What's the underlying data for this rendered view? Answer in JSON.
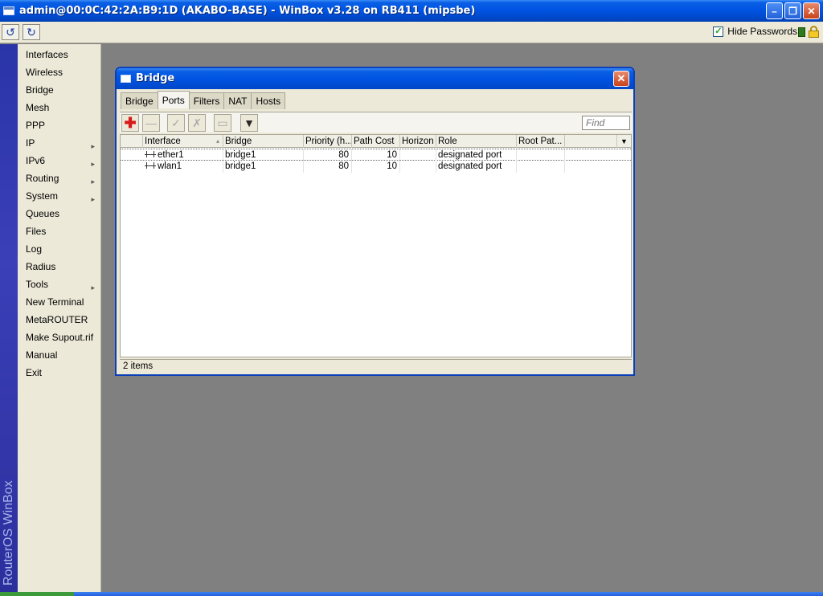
{
  "window": {
    "title": "admin@00:0C:42:2A:B9:1D (AKABO-BASE) - WinBox v3.28 on RB411 (mipsbe)"
  },
  "toolbar": {
    "hide_passwords_label": "Hide Passwords",
    "hide_passwords_checked": true
  },
  "brand": {
    "text": "RouterOS WinBox"
  },
  "menu": {
    "items": [
      {
        "label": "Interfaces",
        "submenu": false
      },
      {
        "label": "Wireless",
        "submenu": false
      },
      {
        "label": "Bridge",
        "submenu": false
      },
      {
        "label": "Mesh",
        "submenu": false
      },
      {
        "label": "PPP",
        "submenu": false
      },
      {
        "label": "IP",
        "submenu": true
      },
      {
        "label": "IPv6",
        "submenu": true
      },
      {
        "label": "Routing",
        "submenu": true
      },
      {
        "label": "System",
        "submenu": true
      },
      {
        "label": "Queues",
        "submenu": false
      },
      {
        "label": "Files",
        "submenu": false
      },
      {
        "label": "Log",
        "submenu": false
      },
      {
        "label": "Radius",
        "submenu": false
      },
      {
        "label": "Tools",
        "submenu": true
      },
      {
        "label": "New Terminal",
        "submenu": false
      },
      {
        "label": "MetaROUTER",
        "submenu": false
      },
      {
        "label": "Make Supout.rif",
        "submenu": false
      },
      {
        "label": "Manual",
        "submenu": false
      },
      {
        "label": "Exit",
        "submenu": false
      }
    ]
  },
  "bridge_window": {
    "title": "Bridge",
    "tabs": [
      "Bridge",
      "Ports",
      "Filters",
      "NAT",
      "Hosts"
    ],
    "active_tab": "Ports",
    "find_placeholder": "Find",
    "columns": [
      "Interface",
      "Bridge",
      "Priority (h...",
      "Path Cost",
      "Horizon",
      "Role",
      "Root Pat..."
    ],
    "rows": [
      {
        "interface": "ether1",
        "bridge": "bridge1",
        "priority": "80",
        "path_cost": "10",
        "horizon": "",
        "role": "designated port",
        "root_path": ""
      },
      {
        "interface": "wlan1",
        "bridge": "bridge1",
        "priority": "80",
        "path_cost": "10",
        "horizon": "",
        "role": "designated port",
        "root_path": ""
      }
    ],
    "status": "2 items"
  },
  "colors": {
    "titlebar_blue": "#0054e3",
    "menu_bg": "#ece9d8",
    "brand_strip": "#2a35a8",
    "desktop": "#808080"
  }
}
